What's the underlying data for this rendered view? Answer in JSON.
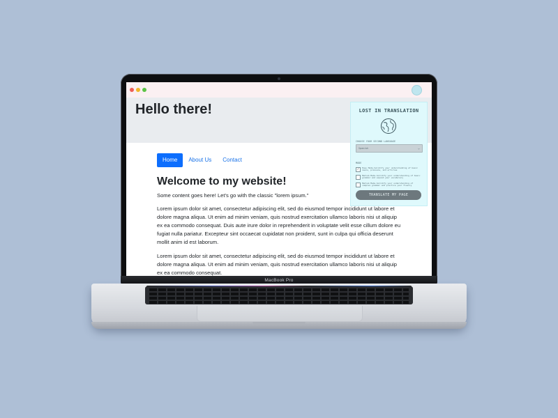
{
  "device": {
    "label": "MacBook Pro"
  },
  "page": {
    "hero_title": "Hello there!",
    "nav": [
      {
        "label": "Home",
        "active": true
      },
      {
        "label": "About Us",
        "active": false
      },
      {
        "label": "Contact",
        "active": false
      }
    ],
    "heading": "Welcome to my website!",
    "lead": "Some content goes here! Let's go with the classic \"lorem ipsum.\"",
    "paragraphs": [
      "Lorem ipsum dolor sit amet, consectetur adipiscing elit, sed do eiusmod tempor incididunt ut labore et dolore magna aliqua. Ut enim ad minim veniam, quis nostrud exercitation ullamco laboris nisi ut aliquip ex ea commodo consequat. Duis aute irure dolor in reprehenderit in voluptate velit esse cillum dolore eu fugiat nulla pariatur. Excepteur sint occaecat cupidatat non proident, sunt in culpa qui officia deserunt mollit anim id est laborum.",
      "Lorem ipsum dolor sit amet, consectetur adipiscing elit, sed do eiusmod tempor incididunt ut labore et dolore magna aliqua. Ut enim ad minim veniam, quis nostrud exercitation ullamco laboris nisi ut aliquip ex ea commodo consequat."
    ]
  },
  "extension": {
    "title": "LOST IN TRANSLATION",
    "icon": "globe-icon",
    "language_label": "CHOOSE YOUR SECOND LANGUAGE",
    "language_value": "Spanish",
    "mode_label": "MODE",
    "modes": [
      {
        "text": "Easy Mode-Solidify your understanding of basic nouns, pronouns, and articles",
        "checked": true
      },
      {
        "text": "Medium Mode-Solidify your understanding of basic grammar and expand your vocabulary",
        "checked": false
      },
      {
        "text": "Medium Mode-Solidify your understanding of complex grammar and practice your fluency",
        "checked": false
      }
    ],
    "button": "TRANSLATE MY PAGE"
  },
  "colors": {
    "background": "#aebfd6",
    "primary": "#0d6efd",
    "panel": "#dff9fc",
    "button": "#6d787d"
  }
}
